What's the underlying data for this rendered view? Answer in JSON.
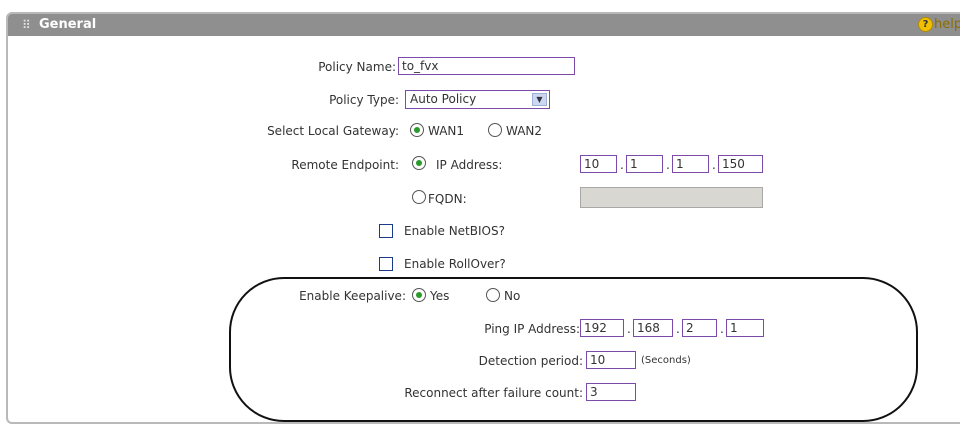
{
  "section": {
    "title": "General",
    "help_label": "help"
  },
  "policy_name": {
    "label": "Policy Name:",
    "value": "to_fvx"
  },
  "policy_type": {
    "label": "Policy Type:",
    "value": "Auto Policy"
  },
  "local_gateway": {
    "label": "Select Local Gateway:",
    "options": [
      "WAN1",
      "WAN2"
    ],
    "selected": "WAN1"
  },
  "remote_endpoint": {
    "label": "Remote Endpoint:",
    "ip_option": "IP Address:",
    "ip": [
      "10",
      "1",
      "1",
      "150"
    ],
    "fqdn_option": "FQDN:",
    "fqdn_value": ""
  },
  "enable_netbios": {
    "label": "Enable NetBIOS?",
    "checked": false
  },
  "enable_rollover": {
    "label": "Enable RollOver?",
    "checked": false
  },
  "keepalive": {
    "label": "Enable Keepalive:",
    "yes": "Yes",
    "no": "No",
    "selected": "Yes",
    "ping_label": "Ping IP Address:",
    "ping_ip": [
      "192",
      "168",
      "2",
      "1"
    ],
    "detection_label": "Detection period:",
    "detection_value": "10",
    "detection_unit": "(Seconds)",
    "reconnect_label": "Reconnect after failure count:",
    "reconnect_value": "3"
  },
  "colors": {
    "header": "#8f8f8f",
    "input_border": "#7a4ba8",
    "radio_selected": "#2a9a2a"
  }
}
